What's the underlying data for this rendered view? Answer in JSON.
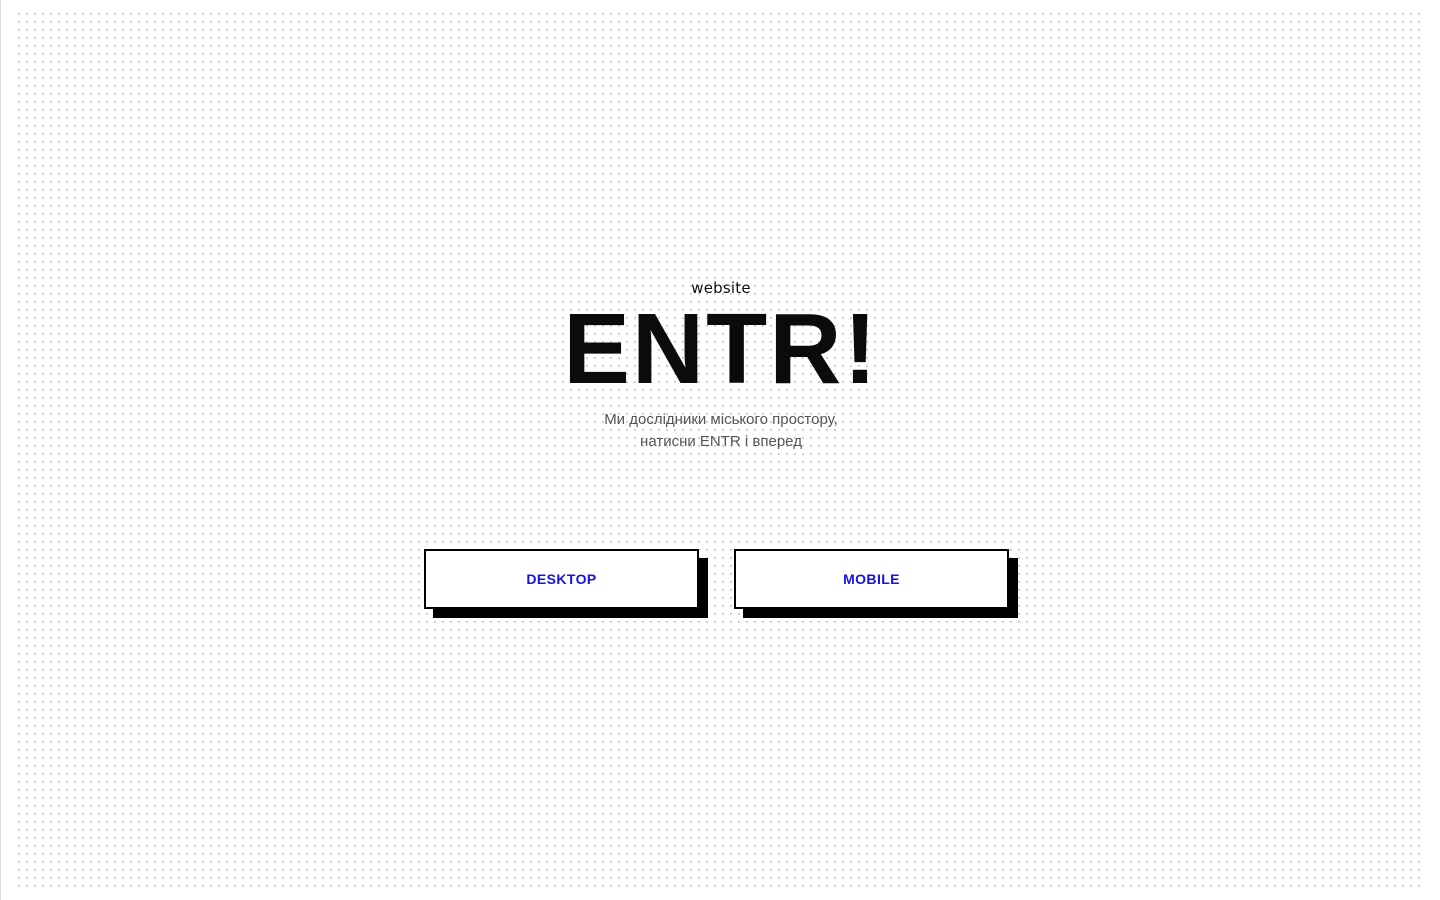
{
  "hero": {
    "eyebrow": "website",
    "brand": "ENTR!",
    "tagline_line1": "Ми дослідники міського простору,",
    "tagline_line2": "натисни ENTR і вперед"
  },
  "buttons": {
    "desktop_label": "DESKTOP",
    "mobile_label": "MOBILE"
  },
  "colors": {
    "background": "#ffffff",
    "dots": "#c9c9c9",
    "brand_text": "#0b0b0b",
    "tagline_text": "#555555",
    "button_text": "#1414e0",
    "button_border": "#000000",
    "button_shadow": "#000000"
  }
}
